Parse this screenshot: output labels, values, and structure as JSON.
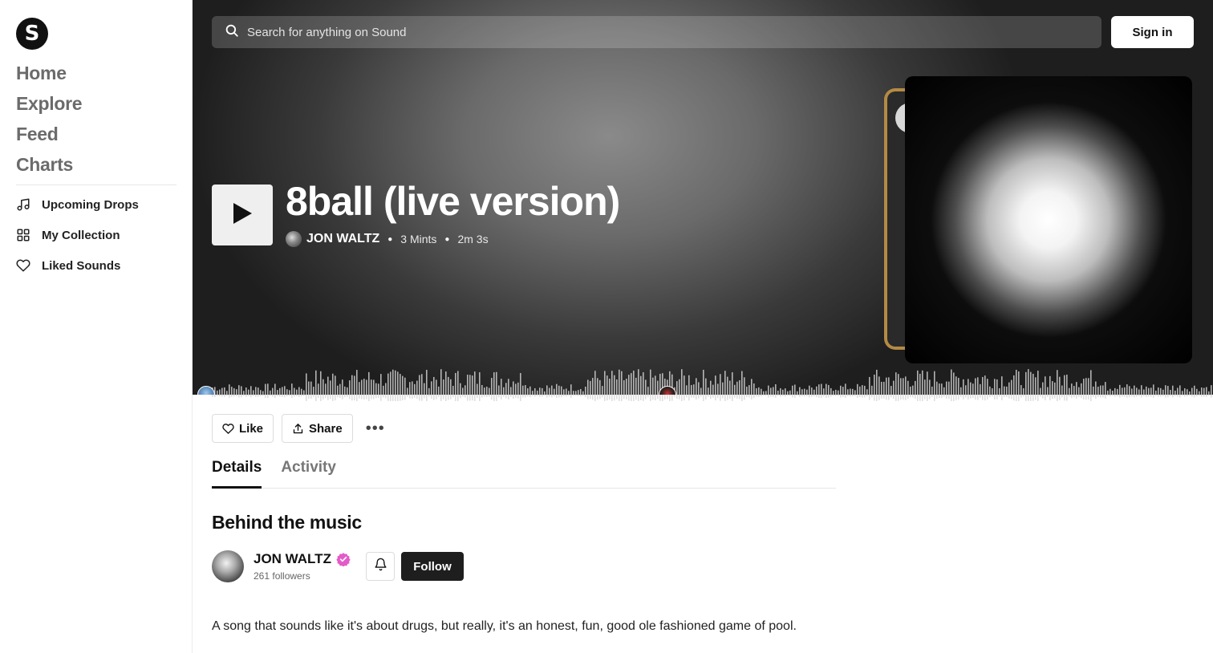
{
  "sidebar": {
    "logo_letter": "S",
    "main_nav": [
      {
        "label": "Home"
      },
      {
        "label": "Explore"
      },
      {
        "label": "Feed"
      },
      {
        "label": "Charts"
      }
    ],
    "sub_nav": [
      {
        "label": "Upcoming Drops",
        "icon": "music-note-icon"
      },
      {
        "label": "My Collection",
        "icon": "grid-icon"
      },
      {
        "label": "Liked Sounds",
        "icon": "heart-icon"
      }
    ]
  },
  "header": {
    "search_placeholder": "Search for anything on Sound",
    "sign_in_label": "Sign in"
  },
  "track": {
    "title": "8ball (live version)",
    "artist": "JON WALTZ",
    "mints": "3 Mints",
    "duration": "2m 3s"
  },
  "actions": {
    "like_label": "Like",
    "share_label": "Share",
    "more_label": "•••"
  },
  "tabs": [
    {
      "label": "Details",
      "active": true
    },
    {
      "label": "Activity",
      "active": false
    }
  ],
  "details": {
    "section_title": "Behind the music",
    "artist_name": "JON WALTZ",
    "followers": "261 followers",
    "follow_label": "Follow",
    "description": "A song that sounds like it's about drugs, but really, it's an honest, fun,  good ole fashioned game of pool."
  },
  "colors": {
    "verified": "#e45ac8",
    "follow_bg": "#1e1e1e"
  }
}
